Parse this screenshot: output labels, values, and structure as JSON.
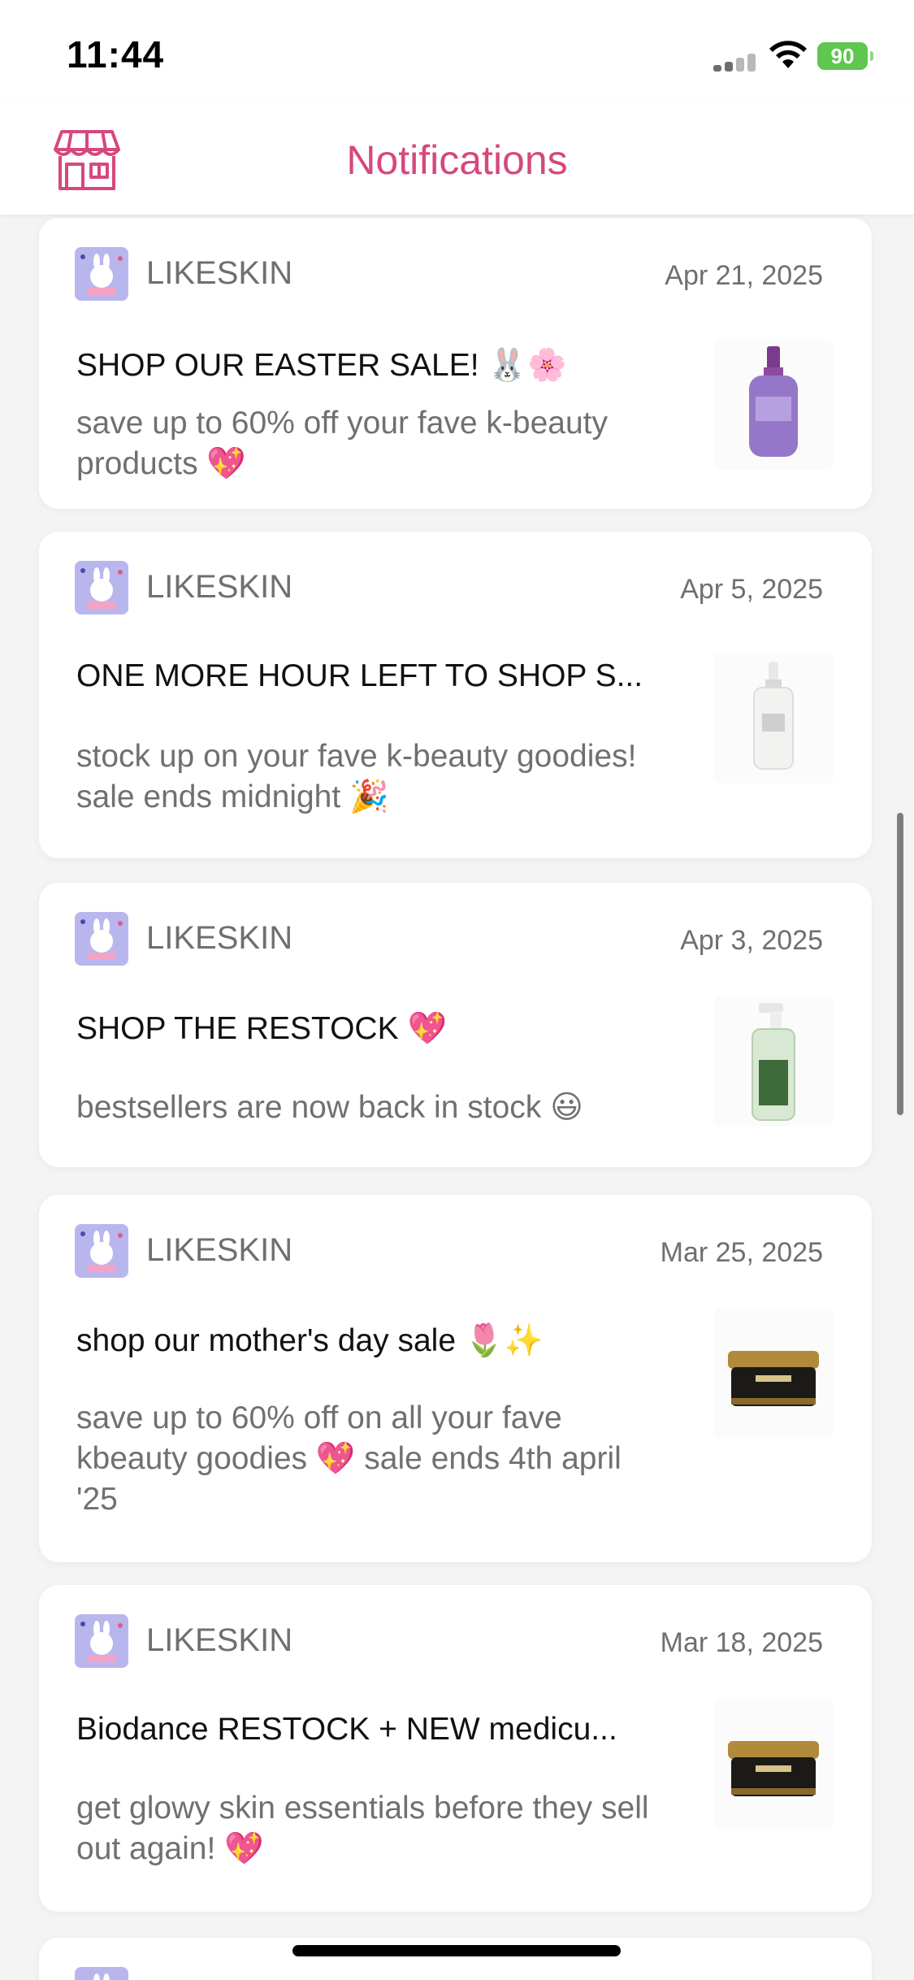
{
  "status_bar": {
    "time": "11:44",
    "battery": "90"
  },
  "header": {
    "title": "Notifications",
    "store_icon": "store-icon"
  },
  "notifications": [
    {
      "sender": "LIKESKIN",
      "date": "Apr 21, 2025",
      "title": "SHOP OUR EASTER SALE! 🐰🌸",
      "body": "save up to 60% off your fave k-beauty products 💖",
      "thumbnail": "purple-serum-bottle"
    },
    {
      "sender": "LIKESKIN",
      "date": "Apr 5, 2025",
      "title": "ONE MORE HOUR LEFT TO SHOP S...",
      "body": "stock up on your fave k-beauty goodies! sale ends midnight 🎉",
      "thumbnail": "clear-dropper-bottle"
    },
    {
      "sender": "LIKESKIN",
      "date": "Apr 3, 2025",
      "title": "SHOP THE RESTOCK 💖",
      "body": "bestsellers are now back in stock 😃",
      "thumbnail": "green-spray-bottle"
    },
    {
      "sender": "LIKESKIN",
      "date": "Mar 25, 2025",
      "title": "shop our mother's day sale 🌷✨",
      "body": "save up to 60% off on all your fave kbeauty goodies 💖 sale ends 4th april '25",
      "thumbnail": "gold-cream-jar"
    },
    {
      "sender": "LIKESKIN",
      "date": "Mar 18, 2025",
      "title": "Biodance RESTOCK + NEW medicu...",
      "body": "get glowy skin essentials before they sell out again! 💖",
      "thumbnail": "gold-cream-jar"
    }
  ]
}
